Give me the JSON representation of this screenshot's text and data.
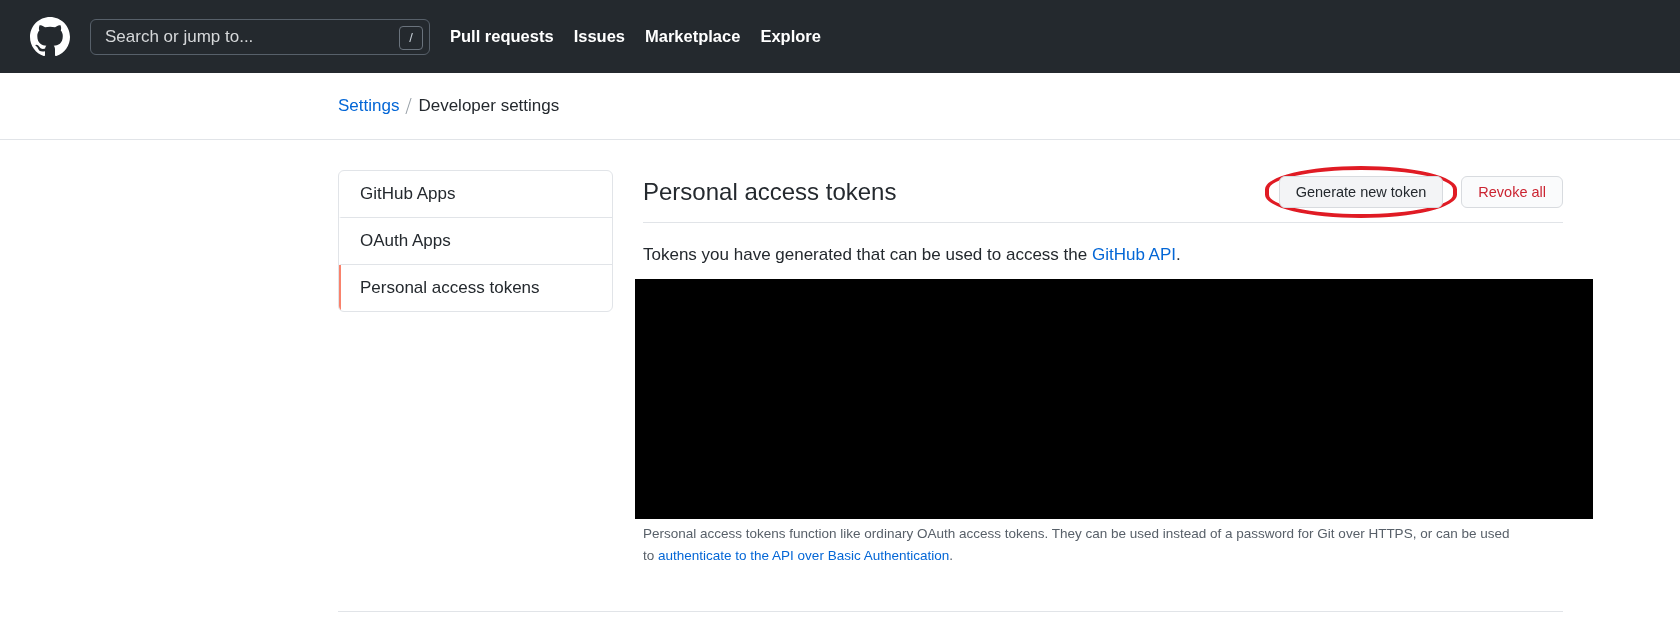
{
  "header": {
    "search": {
      "placeholder": "Search or jump to...",
      "shortcut": "/"
    },
    "nav": [
      "Pull requests",
      "Issues",
      "Marketplace",
      "Explore"
    ]
  },
  "breadcrumb": {
    "parent": "Settings",
    "current": "Developer settings"
  },
  "sidebar": {
    "items": [
      {
        "label": "GitHub Apps",
        "selected": false
      },
      {
        "label": "OAuth Apps",
        "selected": false
      },
      {
        "label": "Personal access tokens",
        "selected": true
      }
    ]
  },
  "main": {
    "title": "Personal access tokens",
    "buttons": [
      {
        "label": "Generate new token",
        "kind": "default",
        "highlighted": true
      },
      {
        "label": "Revoke all",
        "kind": "danger",
        "highlighted": false
      }
    ],
    "intro": {
      "before": "Tokens you have generated that can be used to access the ",
      "link": "GitHub API",
      "after": "."
    },
    "note": {
      "before": "Personal access tokens function like ordinary OAuth access tokens. They can be used instead of a password for Git over HTTPS, or can be used to ",
      "link": "authenticate to the API over Basic Authentication",
      "after": "."
    }
  }
}
